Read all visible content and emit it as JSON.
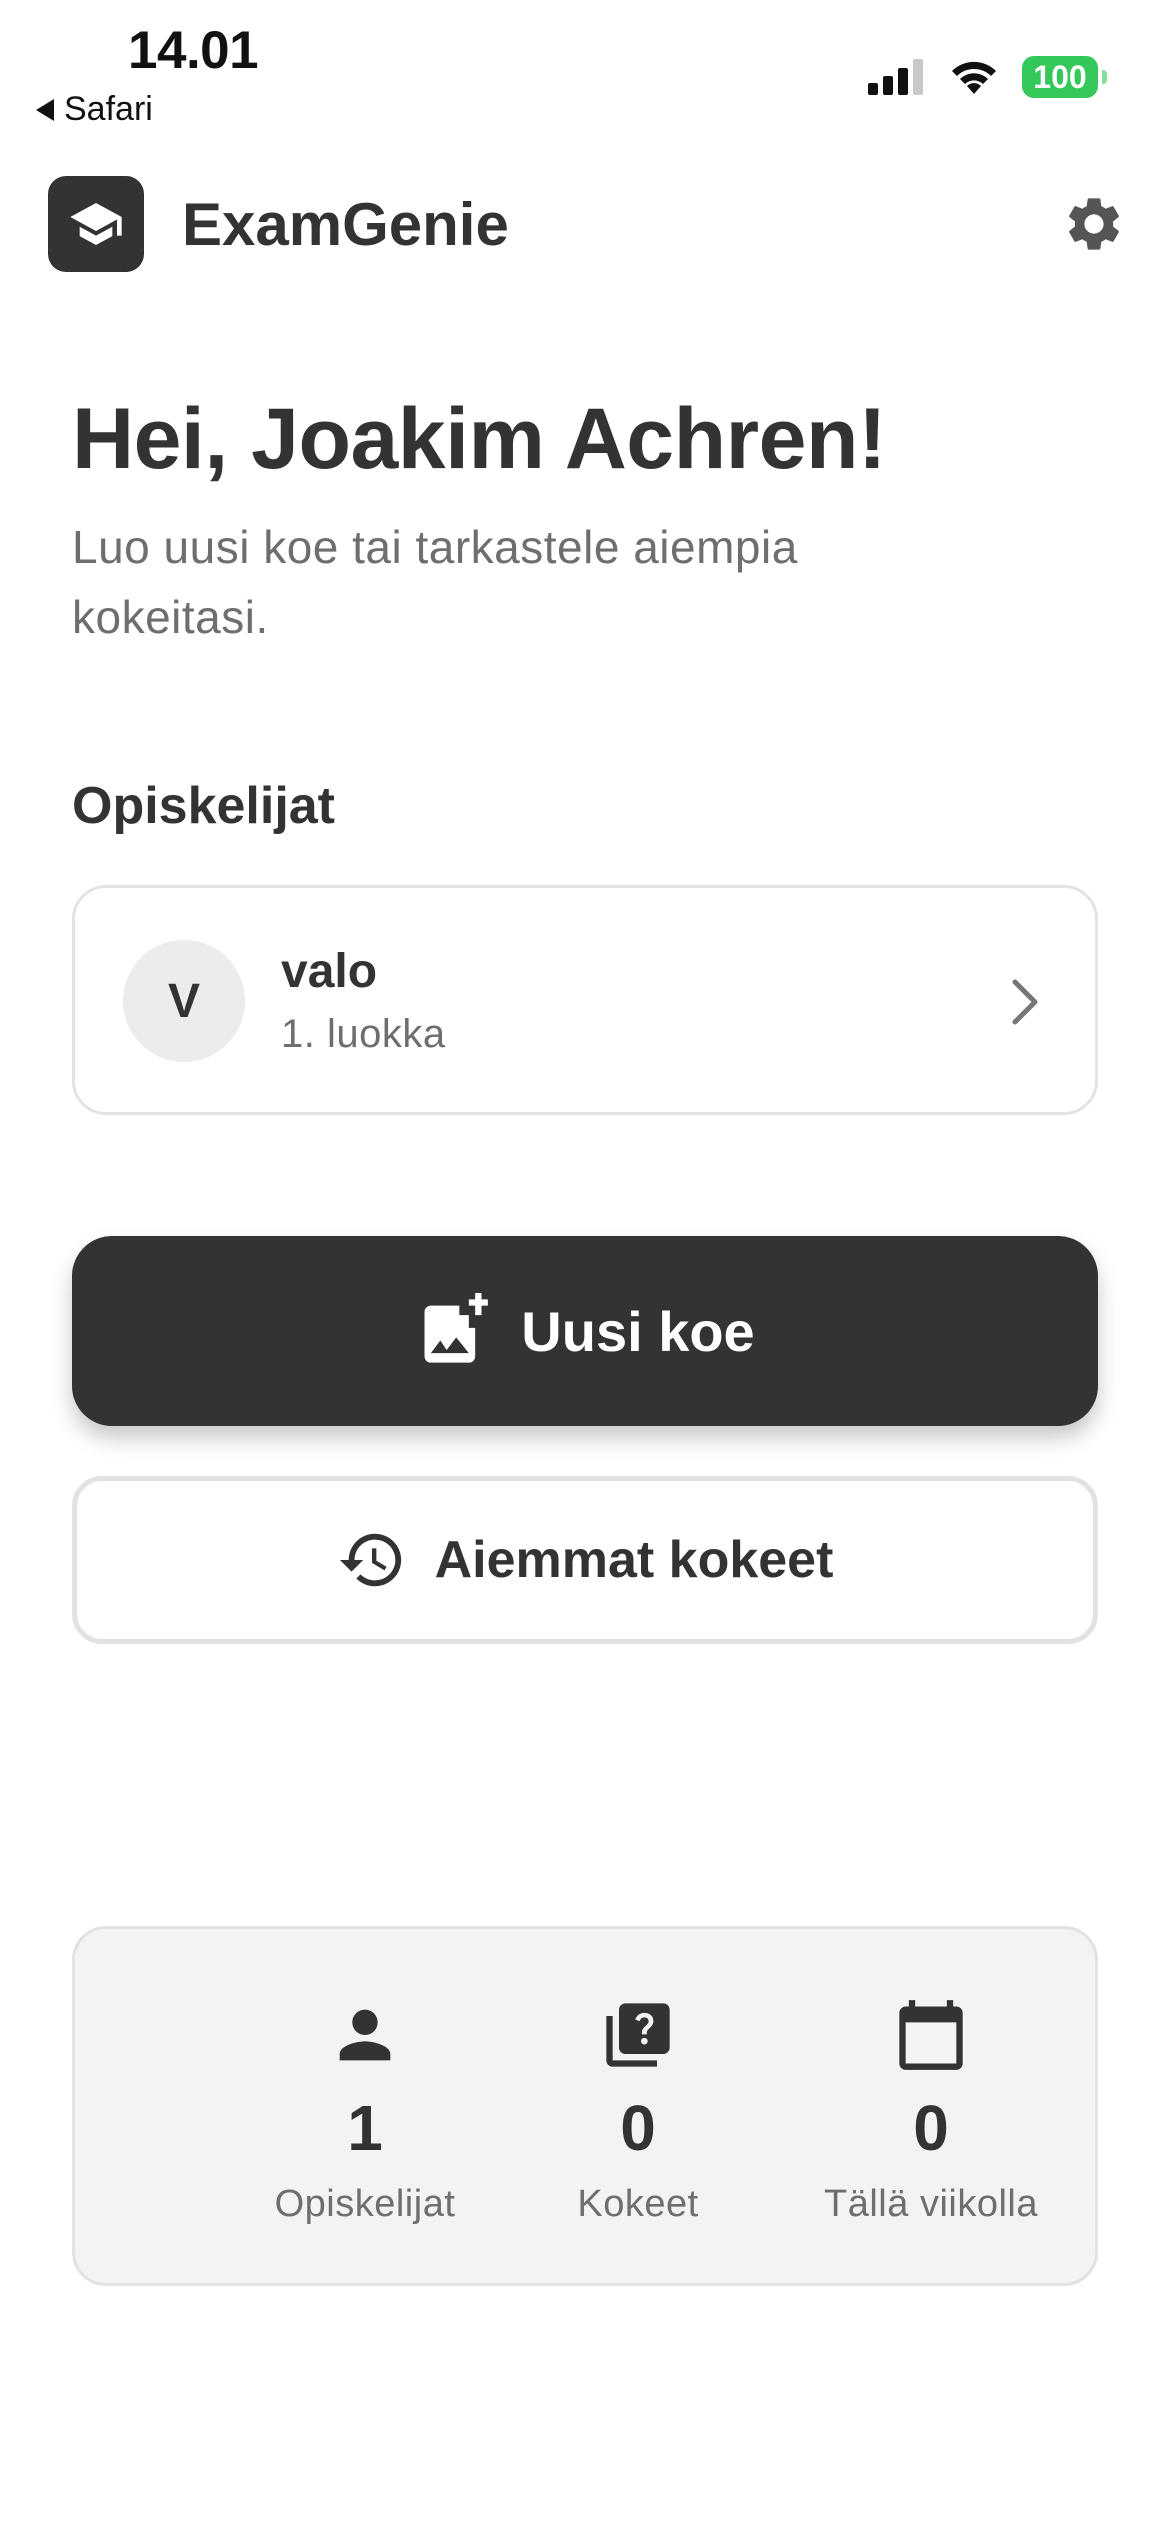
{
  "status_bar": {
    "time": "14.01",
    "back_app": "Safari",
    "battery": "100",
    "battery_color": "#34c759"
  },
  "header": {
    "app_name": "ExamGenie",
    "logo_icon": "graduation-cap-icon",
    "settings_icon": "gear-icon"
  },
  "greeting": {
    "title": "Hei, Joakim Achren!",
    "subtitle": "Luo uusi koe tai tarkastele aiempia kokeitasi."
  },
  "students": {
    "section_title": "Opiskelijat",
    "items": [
      {
        "initial": "V",
        "name": "valo",
        "grade": "1. luokka"
      }
    ]
  },
  "actions": {
    "new_exam_label": "Uusi koe",
    "new_exam_icon": "add-photo-icon",
    "previous_exams_label": "Aiemmat kokeet",
    "previous_exams_icon": "history-icon"
  },
  "stats": [
    {
      "icon": "person-icon",
      "value": "1",
      "label": "Opiskelijat"
    },
    {
      "icon": "quiz-icon",
      "value": "0",
      "label": "Kokeet"
    },
    {
      "icon": "calendar-icon",
      "value": "0",
      "label": "Tällä viikolla"
    }
  ],
  "colors": {
    "primary": "#333333",
    "muted_text": "#6e6e6e",
    "card_border": "#e3e3e3",
    "stats_bg": "#f3f3f3"
  }
}
